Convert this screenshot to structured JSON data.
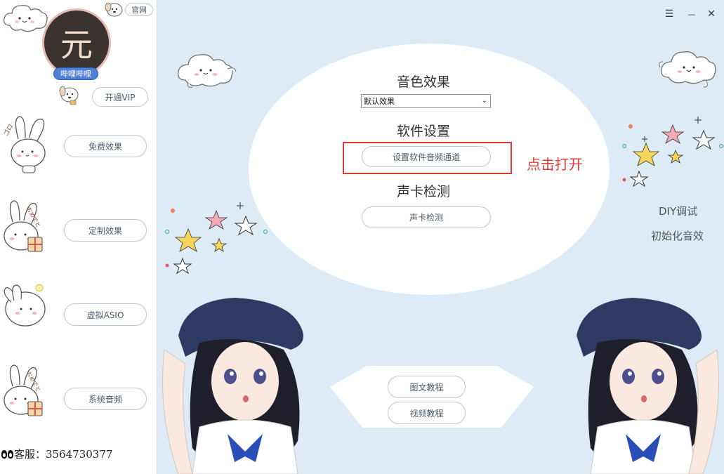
{
  "sidebar": {
    "official_label": "官网",
    "avatar_char": "元",
    "avatar_name": "哔哩哔哩",
    "vip_label": "开通VIP",
    "buttons": [
      {
        "label": "免费效果"
      },
      {
        "label": "定制效果"
      },
      {
        "label": "虚拟ASIO"
      },
      {
        "label": "系统音频"
      }
    ],
    "support_text": "客服：3564730377"
  },
  "window_controls": {
    "menu": "☰",
    "minimize": "—",
    "close": "✕"
  },
  "main": {
    "sound_effect_title": "音色效果",
    "effect_select_value": "默认效果",
    "software_settings_title": "软件设置",
    "set_channel_label": "设置软件音频通道",
    "annotation_text": "点击打开",
    "soundcard_title": "声卡检测",
    "soundcard_button": "声卡检测",
    "right_links": [
      "DIY调试",
      "初始化音效"
    ],
    "tutorial_buttons": [
      "图文教程",
      "视频教程"
    ]
  },
  "colors": {
    "background": "#dcebf5",
    "annotation": "#e53935",
    "avatar_badge": "#4f7fd6"
  }
}
